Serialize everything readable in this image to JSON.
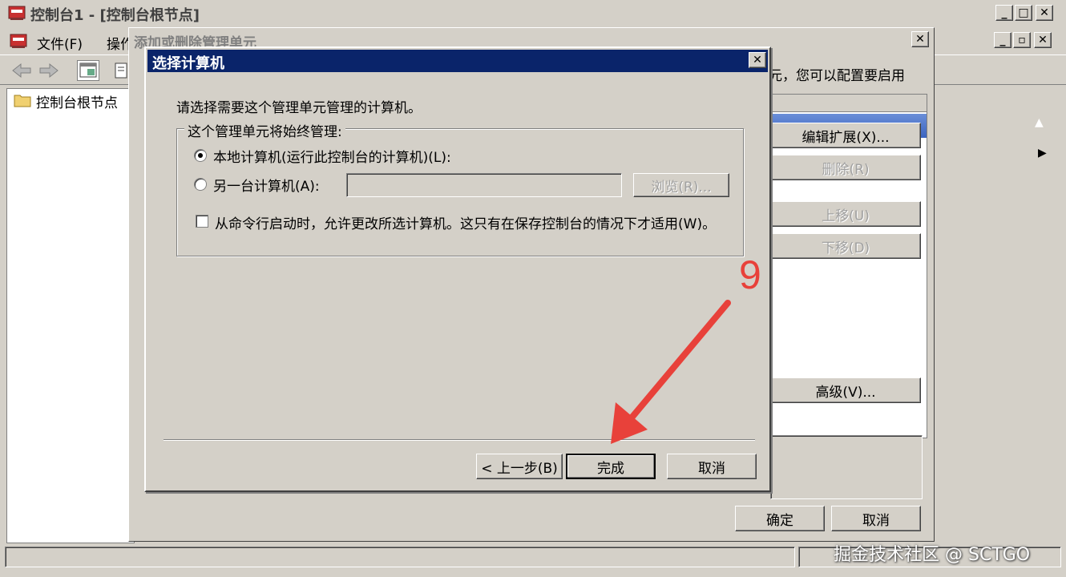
{
  "main_window": {
    "title": "控制台1 - [控制台根节点]",
    "menu": [
      "文件(F)",
      "操作"
    ],
    "tree_root": "控制台根节点"
  },
  "addremove_dialog": {
    "title": "添加或删除管理单元",
    "description_tail": "元，您可以配置要启用",
    "buttons": {
      "edit_ext": "编辑扩展(X)...",
      "remove": "删除(R)",
      "move_up": "上移(U)",
      "move_down": "下移(D)",
      "advanced": "高级(V)...",
      "ok": "确定",
      "cancel": "取消"
    }
  },
  "select_computer_dialog": {
    "title": "选择计算机",
    "instruction": "请选择需要这个管理单元管理的计算机。",
    "group_label": "这个管理单元将始终管理:",
    "options": {
      "local": "本地计算机(运行此控制台的计算机)(L):",
      "another": "另一台计算机(A):",
      "another_value": ""
    },
    "browse_button": "浏览(R)...",
    "allow_change_checkbox": "从命令行启动时，允许更改所选计算机。这只有在保存控制台的情况下才适用(W)。",
    "local_selected": true,
    "allow_change_checked": false,
    "buttons": {
      "back": "< 上一步(B)",
      "finish": "完成",
      "cancel": "取消"
    }
  },
  "annotation": {
    "step_number": "9",
    "color": "#e8413a"
  },
  "watermark": "掘金技术社区 @ SCTGO"
}
